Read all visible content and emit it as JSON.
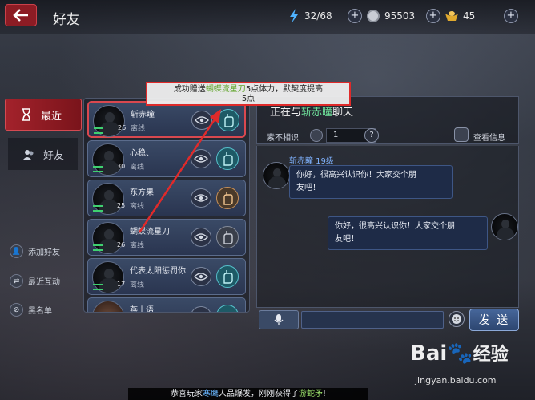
{
  "header": {
    "title": "好友"
  },
  "resources": {
    "stamina": "32/68",
    "coins": "95503",
    "gold": "45"
  },
  "nav": {
    "recent": "最近",
    "friends": "好友"
  },
  "side_actions": {
    "add_friend": "添加好友",
    "recent_interaction": "最近互动",
    "blacklist": "黑名单"
  },
  "friends": [
    {
      "name": "斩赤瞳",
      "level": "26",
      "status": "离线"
    },
    {
      "name": "心稳、",
      "level": "30",
      "status": "离线"
    },
    {
      "name": "东方果",
      "level": "25",
      "status": "离线"
    },
    {
      "name": "蝴蝶流星刀",
      "level": "26",
      "status": "离线"
    },
    {
      "name": "代表太阳惩罚你",
      "level": "17",
      "status": "离线"
    },
    {
      "name": "燕十语",
      "level": "",
      "status": ""
    }
  ],
  "chat": {
    "title_prefix": "正在与",
    "title_name": "斩赤瞳",
    "title_suffix": "聊天",
    "relation_label": "素不相识",
    "relation_value": "1",
    "help": "?",
    "view_info": "查看信息",
    "messages": [
      {
        "sender": "斩赤瞳  19级",
        "text_line1": "你好，很高兴认识你！大家交个朋",
        "text_line2": "友吧！"
      },
      {
        "sender": "",
        "text_line1": "你好，很高兴认识你！大家交个朋",
        "text_line2": "友吧！"
      }
    ],
    "input_value": "",
    "send_label": "发 送"
  },
  "toast": {
    "prefix": "成功赠送",
    "name": "蝴蝶流星刀",
    "suffix": "5点体力，默契度提高",
    "line2": "5点"
  },
  "marquee": {
    "p1": "恭喜玩家",
    "p2": "寒鹰",
    "p3": "人品爆发，刚刚获得了",
    "p4": "游蛇矛",
    "p5": "!"
  },
  "watermark": {
    "main_latin": "Bai",
    "main_cn": "经验",
    "sub": "jingyan.baidu.com"
  },
  "colors": {
    "accent_red": "#a3222b",
    "card_blue": "#3a4a66",
    "highlight_green": "#6ee09a",
    "name_blue": "#7fb2ff",
    "toast_border": "#e02a2a"
  }
}
